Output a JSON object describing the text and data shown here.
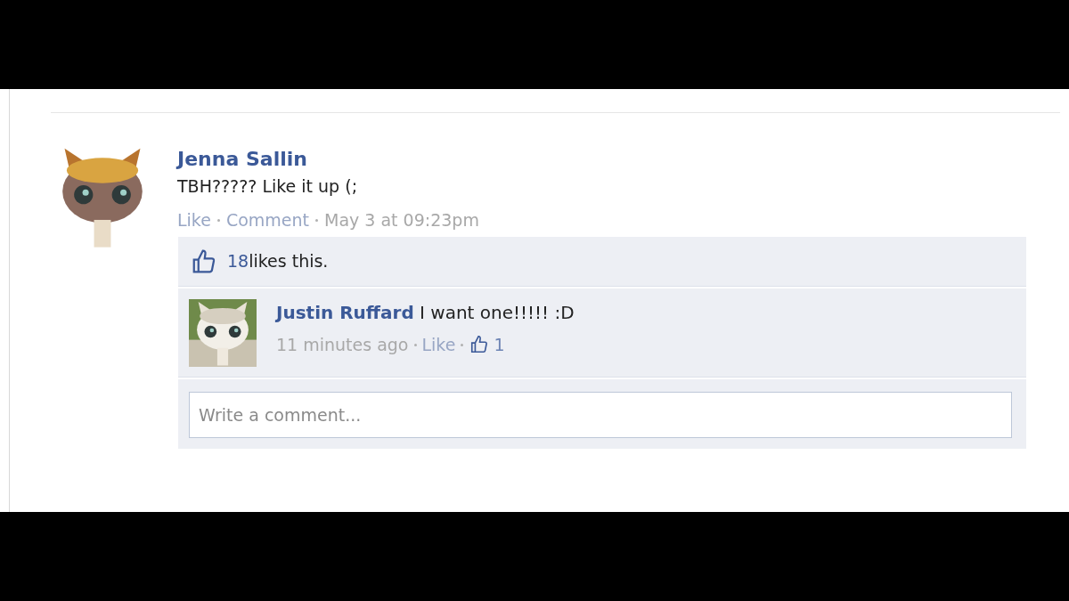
{
  "post": {
    "author": "Jenna Sallin",
    "text": "TBH????? Like it up (;",
    "actions": [
      "Like",
      "Comment"
    ],
    "time": "May 3 at 09:23pm"
  },
  "likes": {
    "count": "18",
    "text": "likes this."
  },
  "comments": [
    {
      "author": "Justin Ruffard",
      "text": "I want one!!!!! :D",
      "time": "11 minutes ago",
      "action": "Like",
      "like_count": "1"
    }
  ],
  "comment_box": {
    "placeholder": "Write a comment..."
  }
}
